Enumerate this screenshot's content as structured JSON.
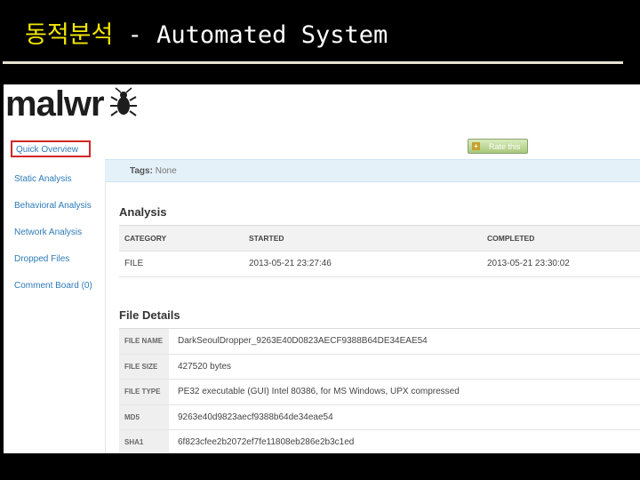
{
  "slide": {
    "title_korean": "동적분석",
    "title_rest": " - Automated System"
  },
  "app": {
    "logo_text": "malwr",
    "rate_button": "Rate this"
  },
  "sidebar": {
    "items": [
      {
        "label": "Quick Overview",
        "active": true
      },
      {
        "label": "Static Analysis"
      },
      {
        "label": "Behavioral Analysis"
      },
      {
        "label": "Network Analysis"
      },
      {
        "label": "Dropped Files"
      },
      {
        "label": "Comment Board (0)"
      }
    ]
  },
  "tags": {
    "label": "Tags:",
    "value": "None"
  },
  "analysis": {
    "heading": "Analysis",
    "columns": [
      "CATEGORY",
      "STARTED",
      "COMPLETED"
    ],
    "row": [
      "FILE",
      "2013-05-21 23:27:46",
      "2013-05-21 23:30:02"
    ]
  },
  "file_details": {
    "heading": "File Details",
    "rows": [
      {
        "key": "FILE NAME",
        "value": "DarkSeoulDropper_9263E40D0823AECF9388B64DE34EAE54"
      },
      {
        "key": "FILE SIZE",
        "value": "427520 bytes"
      },
      {
        "key": "FILE TYPE",
        "value": "PE32 executable (GUI) Intel 80386, for MS Windows, UPX compressed"
      },
      {
        "key": "MD5",
        "value": "9263e40d9823aecf9388b64de34eae54"
      },
      {
        "key": "SHA1",
        "value": "6f823cfee2b2072ef7fe11808eb286e2b3c1ed"
      }
    ]
  },
  "colors": {
    "title_korean": "#f3e600",
    "link": "#2d7ab8",
    "active_outline": "#d12626",
    "tags_bg": "#e4f1f9"
  }
}
